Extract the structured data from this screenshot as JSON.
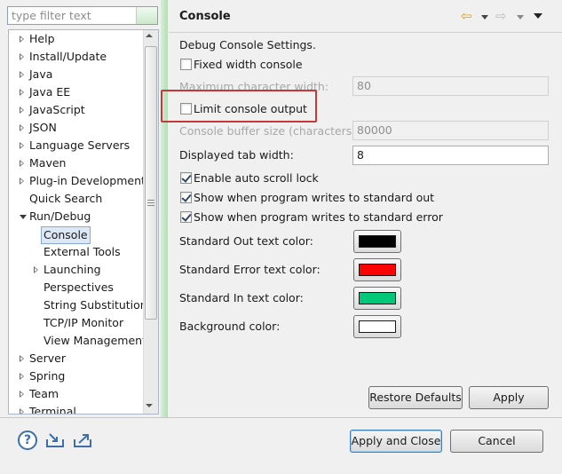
{
  "filter": {
    "placeholder": "type filter text"
  },
  "tree": [
    {
      "label": "Help",
      "indent": 0,
      "state": "closed"
    },
    {
      "label": "Install/Update",
      "indent": 0,
      "state": "closed"
    },
    {
      "label": "Java",
      "indent": 0,
      "state": "closed"
    },
    {
      "label": "Java EE",
      "indent": 0,
      "state": "closed"
    },
    {
      "label": "JavaScript",
      "indent": 0,
      "state": "closed"
    },
    {
      "label": "JSON",
      "indent": 0,
      "state": "closed"
    },
    {
      "label": "Language Servers",
      "indent": 0,
      "state": "closed"
    },
    {
      "label": "Maven",
      "indent": 0,
      "state": "closed"
    },
    {
      "label": "Plug-in Development",
      "indent": 0,
      "state": "closed"
    },
    {
      "label": "Quick Search",
      "indent": 0,
      "state": "leaf"
    },
    {
      "label": "Run/Debug",
      "indent": 0,
      "state": "open"
    },
    {
      "label": "Console",
      "indent": 1,
      "state": "leaf",
      "selected": true
    },
    {
      "label": "External Tools",
      "indent": 1,
      "state": "leaf"
    },
    {
      "label": "Launching",
      "indent": 1,
      "state": "closed"
    },
    {
      "label": "Perspectives",
      "indent": 1,
      "state": "leaf"
    },
    {
      "label": "String Substitution",
      "indent": 1,
      "state": "leaf"
    },
    {
      "label": "TCP/IP Monitor",
      "indent": 1,
      "state": "leaf"
    },
    {
      "label": "View Management",
      "indent": 1,
      "state": "leaf"
    },
    {
      "label": "Server",
      "indent": 0,
      "state": "closed"
    },
    {
      "label": "Spring",
      "indent": 0,
      "state": "closed"
    },
    {
      "label": "Team",
      "indent": 0,
      "state": "closed"
    },
    {
      "label": "Terminal",
      "indent": 0,
      "state": "closed"
    }
  ],
  "page": {
    "title": "Console",
    "section": "Debug Console Settings.",
    "fixed_width": {
      "label": "Fixed width console",
      "checked": false
    },
    "max_chars": {
      "label": "Maximum character width:",
      "value": "80"
    },
    "limit_output": {
      "label": "Limit console output",
      "checked": false
    },
    "buffer_size": {
      "label": "Console buffer size (characters):",
      "value": "80000"
    },
    "tab_width": {
      "label": "Displayed tab width:",
      "value": "8"
    },
    "auto_scroll": {
      "label": "Enable auto scroll lock",
      "checked": true
    },
    "show_stdout": {
      "label": "Show when program writes to standard out",
      "checked": true
    },
    "show_stderr": {
      "label": "Show when program writes to standard error",
      "checked": true
    },
    "colors": [
      {
        "label": "Standard Out text color:",
        "color": "#000000"
      },
      {
        "label": "Standard Error text color:",
        "color": "#ff0000"
      },
      {
        "label": "Standard In text color:",
        "color": "#00c878"
      },
      {
        "label": "Background color:",
        "color": "#ffffff"
      }
    ],
    "restore_defaults": "Restore Defaults",
    "apply": "Apply"
  },
  "footer": {
    "help_glyph": "?",
    "apply_close": "Apply and Close",
    "cancel": "Cancel"
  },
  "icons": {
    "nav_back": "⇦",
    "nav_forward": "⇨"
  }
}
